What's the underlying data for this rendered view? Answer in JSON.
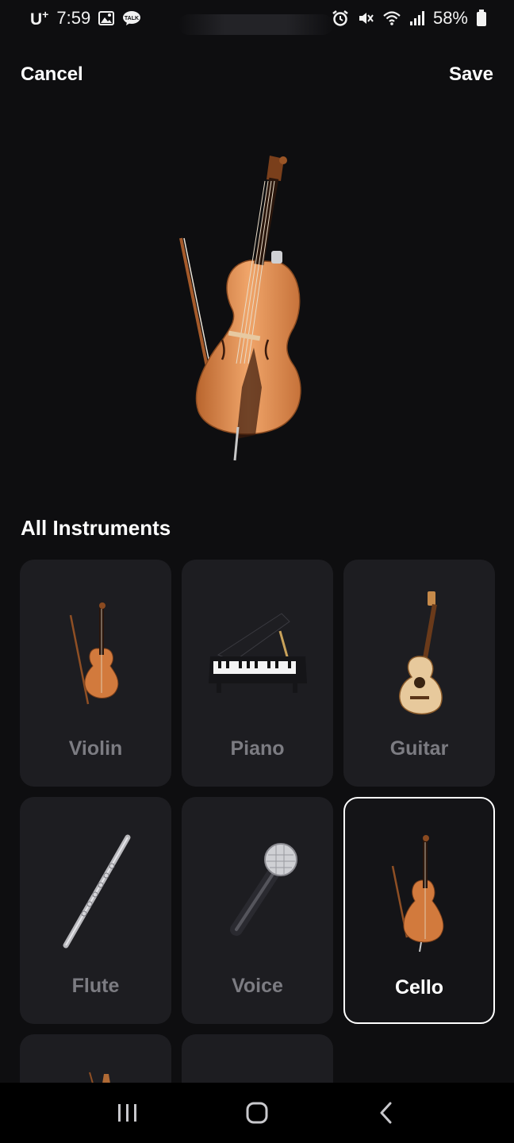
{
  "status_bar": {
    "carrier": "U",
    "carrier_sup": "+",
    "time": "7:59",
    "battery": "58%"
  },
  "header": {
    "cancel_label": "Cancel",
    "save_label": "Save"
  },
  "selected_instrument": "Cello",
  "section_title": "All Instruments",
  "instruments": [
    {
      "label": "Violin",
      "icon": "violin-icon",
      "selected": false
    },
    {
      "label": "Piano",
      "icon": "piano-icon",
      "selected": false
    },
    {
      "label": "Guitar",
      "icon": "guitar-icon",
      "selected": false
    },
    {
      "label": "Flute",
      "icon": "flute-icon",
      "selected": false
    },
    {
      "label": "Voice",
      "icon": "microphone-icon",
      "selected": false
    },
    {
      "label": "Cello",
      "icon": "cello-icon",
      "selected": true
    }
  ],
  "colors": {
    "background": "#0e0e10",
    "card": "#1d1d21",
    "label_inactive": "#7c7c82",
    "selected_border": "#ffffff",
    "wood": "#d9864a"
  },
  "nav_bar": {
    "icons": [
      "recent-apps-icon",
      "home-icon",
      "back-icon"
    ]
  }
}
